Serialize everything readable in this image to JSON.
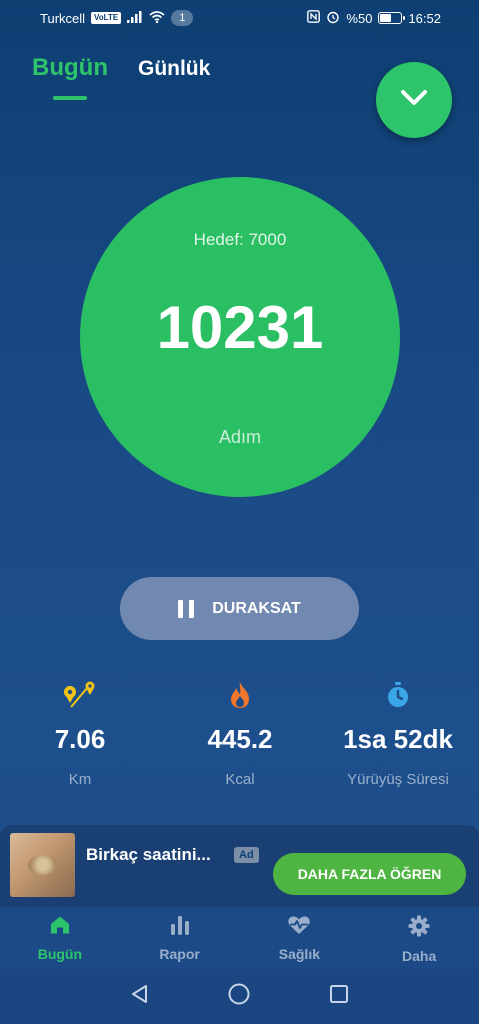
{
  "status_bar": {
    "carrier": "Turkcell",
    "volte": "VoLTE",
    "notification_count": "1",
    "battery": "%50",
    "time": "16:52"
  },
  "tabs": [
    {
      "label": "Bugün",
      "active": true
    },
    {
      "label": "Günlük",
      "active": false
    }
  ],
  "fab": {
    "icon": "chevron-down-icon"
  },
  "steps": {
    "goal_label": "Hedef: 7000",
    "count": "10231",
    "unit": "Adım"
  },
  "pause_button": {
    "label": "DURAKSAT",
    "icon": "pause-icon"
  },
  "stats": [
    {
      "value": "7.06",
      "label": "Km",
      "icon": "map-pins-icon"
    },
    {
      "value": "445.2",
      "label": "Kcal",
      "icon": "flame-icon"
    },
    {
      "value": "1sa 52dk",
      "label": "Yürüyüş Süresi",
      "icon": "stopwatch-icon"
    }
  ],
  "ad": {
    "title": "Birkaç saatini...",
    "badge": "Ad",
    "cta": "DAHA FAZLA ÖĞREN"
  },
  "bottom_nav": [
    {
      "label": "Bugün",
      "icon": "home-icon",
      "active": true
    },
    {
      "label": "Rapor",
      "icon": "bar-chart-icon",
      "active": false
    },
    {
      "label": "Sağlık",
      "icon": "heart-pulse-icon",
      "active": false
    },
    {
      "label": "Daha",
      "icon": "gear-icon",
      "active": false
    }
  ],
  "colors": {
    "accent": "#2dc46b",
    "background": "#1a4a85",
    "cta_green": "#4fb542"
  }
}
